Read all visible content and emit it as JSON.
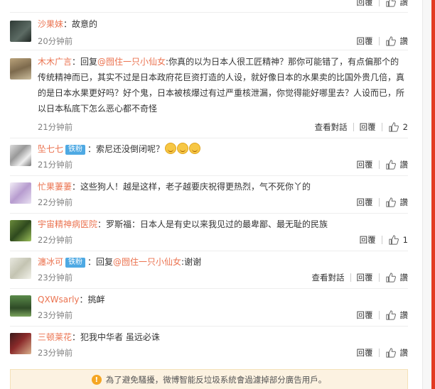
{
  "labels": {
    "reply": "回覆",
    "like": "讚",
    "view_thread": "查看對話"
  },
  "comments": [
    {
      "user": "沙果妹",
      "text": "：故意的",
      "time": "20分钟前"
    },
    {
      "user": "木木广言",
      "prefix": "：回复",
      "reply_to": "@囫住一只小仙女",
      "text": ":你真的以为日本人很工匠精神？那你可能错了，有点偏那个的传统精神而已，其实不过是日本政府花巨资打造的人设，就好像日本的水果卖的比国外贵几倍，真的是日本水果更好吗？好个鬼，日本被核爆过有过严重核泄漏，你觉得能好哪里去？人设而已，所以日本私底下怎么恶心都不奇怪",
      "time": "21分钟前",
      "like_count": "2"
    },
    {
      "user": "坠七七",
      "badge": "铁粉",
      "text": "：索尼还没倒闭呢？",
      "time": "21分钟前"
    },
    {
      "user": "忙果萋萋",
      "text": "：这些狗人！越是这样，老子越要庆祝得更热烈，气不死你丫的",
      "time": "22分钟前"
    },
    {
      "user": "宇宙精神病医院",
      "text": "：罗斯福：日本人是有史以来我见过的最卑鄙、最无耻的民族",
      "time": "22分钟前",
      "like_count": "1"
    },
    {
      "user": "瀍冰可",
      "badge": "铁粉",
      "prefix": "：回复",
      "reply_to": "@囫住一只小仙女",
      "text": ":谢谢",
      "time": "23分钟前"
    },
    {
      "user": "QXWsarly",
      "text": "：挑衅",
      "time": "23分钟前"
    },
    {
      "user": "三顿莱花",
      "text": "：犯我中华者 虽远必诛",
      "time": "23分钟前"
    }
  ],
  "notice": "為了避免騷擾，微博智能反垃圾系統會過濾掉部分廣告用戶。",
  "colors": {
    "username": "#eb7350",
    "notice_bg": "#fcf2e1",
    "badge_bg": "#4ea9e3",
    "scroll_accent": "#e23b22"
  }
}
